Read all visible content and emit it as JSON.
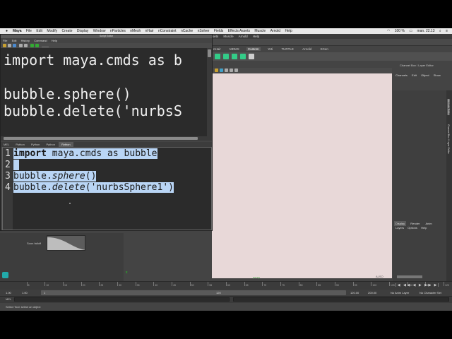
{
  "mac_menubar": {
    "app_menu": "Maya",
    "menus": [
      "File",
      "Edit",
      "Modify",
      "Create",
      "Display",
      "Window",
      "nParticles",
      "nMesh",
      "nHair",
      "nConstraint",
      "nCache",
      "nSolver",
      "Fields",
      "Effects Assets",
      "Muscle",
      "Arnold",
      "Help"
    ],
    "battery": "100 %",
    "clock": "man. 22.13"
  },
  "maya_menu": [
    "File",
    "Edit",
    "Modify",
    "Create",
    "Display",
    "Window",
    "nParticles",
    "nMesh",
    "nHair",
    "nConstraint",
    "nCache",
    "nSolver",
    "Fields",
    "Effects Assets",
    "Muscle",
    "Arnold",
    "Help"
  ],
  "shelf": {
    "tabs": [
      "nHair",
      "MDMX",
      "Custom",
      "Yeti",
      "TURTLE",
      "Arnold",
      "XGen"
    ],
    "active_tab": "Custom"
  },
  "script_editor": {
    "title": "Script Editor",
    "menu": [
      "File",
      "Edit",
      "History",
      "Command",
      "Help"
    ],
    "output_lines": [
      "import maya.cmds as b",
      "",
      "bubble.sphere()",
      "bubble.delete('nurbsS"
    ],
    "tabs": [
      "MEL",
      "Python",
      "Python",
      "Python",
      "Python"
    ],
    "active_tab_index": 4,
    "line_numbers": [
      "1",
      "2",
      "3",
      "4"
    ],
    "code": {
      "l1_kw": "import",
      "l1_rest": " maya.cmds as bubble",
      "l3_obj": "bubble.",
      "l3_fn": "sphere",
      "l3_end": "()",
      "l4_obj": "bubble.",
      "l4_fn": "delete",
      "l4_end": "('nurbsSphere1')"
    }
  },
  "tool_settings": {
    "falloff_label": "Soon falloff"
  },
  "channel_box": {
    "title": "Channel Box / Layer Editor",
    "tabs": [
      "Channels",
      "Edit",
      "Object",
      "Show"
    ],
    "layer_tabs": [
      "Display",
      "Render",
      "Anim"
    ],
    "layer_menu": [
      "Layers",
      "Options",
      "Help"
    ],
    "side_tabs": [
      "Attribute Editor",
      "Channel Box / Layer Editor"
    ]
  },
  "viewport": {
    "axis_label": "x",
    "label_left": "persp",
    "label_right": "ALSO"
  },
  "timeline": {
    "ticks": [
      "5",
      "10",
      "15",
      "20",
      "25",
      "30",
      "35",
      "40",
      "45",
      "50",
      "55",
      "60",
      "65",
      "70",
      "75",
      "80",
      "85",
      "90",
      "95",
      "100",
      "105",
      "110",
      "115",
      "120"
    ],
    "current_frame": "1",
    "playback_controls": "|◀ ◀◀ ◀ ▶ ▶▶ ▶|"
  },
  "range": {
    "start": "1.00",
    "start2": "1.00",
    "range_start": "1",
    "range_end": "120",
    "end": "120.00",
    "end2": "200.00",
    "anim_layer": "No Anim Layer",
    "char_set": "No Character Set"
  },
  "command_line": {
    "label": "MEL"
  },
  "help_line": "Select Tool: select an object"
}
